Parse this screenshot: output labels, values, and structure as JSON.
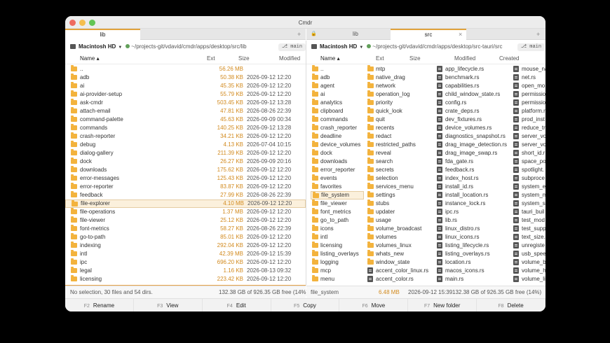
{
  "window": {
    "title": "Cmdr"
  },
  "left": {
    "tab": {
      "label": "lib"
    },
    "drive": "Macintosh HD",
    "path": "~/projects-git/vdavid/cmdr/apps/desktop/src/lib",
    "branch": "main",
    "columns": {
      "name": "Name ▴",
      "ext": "Ext",
      "size": "Size",
      "modified": "Modified"
    },
    "rows": [
      {
        "name": "..",
        "size": "56.26 MB",
        "date": ""
      },
      {
        "name": "adb",
        "size": "50.38 KB",
        "date": "2026-09-12 12:20"
      },
      {
        "name": "ai",
        "size": "45.35 KB",
        "date": "2026-09-12 12:20"
      },
      {
        "name": "ai-provider-setup",
        "size": "55.79 KB",
        "date": "2026-09-12 12:20"
      },
      {
        "name": "ask-cmdr",
        "size": "503.45 KB",
        "date": "2026-09-12 13:28"
      },
      {
        "name": "attach-email",
        "size": "47.81 KB",
        "date": "2026-08-26 22:39"
      },
      {
        "name": "command-palette",
        "size": "45.63 KB",
        "date": "2026-09-09 00:34"
      },
      {
        "name": "commands",
        "size": "140.25 KB",
        "date": "2026-09-12 13:28"
      },
      {
        "name": "crash-reporter",
        "size": "34.21 KB",
        "date": "2026-09-12 12:20"
      },
      {
        "name": "debug",
        "size": "4.13 KB",
        "date": "2026-07-04 10:15"
      },
      {
        "name": "dialog-gallery",
        "size": "211.39 KB",
        "date": "2026-09-12 12:20"
      },
      {
        "name": "dock",
        "size": "26.27 KB",
        "date": "2026-09-09 20:16"
      },
      {
        "name": "downloads",
        "size": "175.62 KB",
        "date": "2026-09-12 12:20"
      },
      {
        "name": "error-messages",
        "size": "125.43 KB",
        "date": "2026-09-12 12:20"
      },
      {
        "name": "error-reporter",
        "size": "83.87 KB",
        "date": "2026-09-12 12:20"
      },
      {
        "name": "feedback",
        "size": "27.99 KB",
        "date": "2026-08-26 22:39"
      },
      {
        "name": "file-explorer",
        "size": "4.10 MB",
        "date": "2026-09-12 12:20"
      },
      {
        "name": "file-operations",
        "size": "1.37 MB",
        "date": "2026-09-12 12:20"
      },
      {
        "name": "file-viewer",
        "size": "25.12 KB",
        "date": "2026-09-12 12:20"
      },
      {
        "name": "font-metrics",
        "size": "58.27 KB",
        "date": "2026-08-26 22:39"
      },
      {
        "name": "go-to-path",
        "size": "85.01 KB",
        "date": "2026-09-12 12:20"
      },
      {
        "name": "indexing",
        "size": "292.04 KB",
        "date": "2026-09-12 12:20"
      },
      {
        "name": "intl",
        "size": "42.39 MB",
        "date": "2026-09-12 15:39"
      },
      {
        "name": "ipc",
        "size": "696.20 KB",
        "date": "2026-09-12 12:20"
      },
      {
        "name": "legal",
        "size": "1.16 KB",
        "date": "2026-08-13 09:32"
      },
      {
        "name": "licensing",
        "size": "223.42 KB",
        "date": "2026-09-12 12:20"
      }
    ],
    "status": {
      "left": "No selection, 30 files and 54 dirs.",
      "right": "132.38 GB of 926.35 GB free (14%)"
    }
  },
  "right": {
    "tab_inactive": {
      "label": "lib"
    },
    "tab": {
      "label": "src"
    },
    "drive": "Macintosh HD",
    "path": "~/projects-git/vdavid/cmdr/apps/desktop/src-tauri/src",
    "branch": "main",
    "columns": {
      "name": "Name ▴",
      "ext": "Ext",
      "size": "Size",
      "modified": "Modified",
      "created": "Created"
    },
    "col1": [
      "..",
      "adb",
      "agent",
      "ai",
      "analytics",
      "clipboard",
      "commands",
      "crash_reporter",
      "deadline",
      "device_volumes",
      "dock",
      "downloads",
      "error_reporter",
      "events",
      "favorites",
      "file_system",
      "file_viewer",
      "font_metrics",
      "go_to_path",
      "icons",
      "intl",
      "licensing",
      "listing_overlays",
      "logging",
      "mcp",
      "menu"
    ],
    "col2": [
      "mtp",
      "native_drag",
      "network",
      "operation_log",
      "priority",
      "quick_look",
      "quit",
      "recents",
      "redact",
      "restricted_paths",
      "reveal",
      "search",
      "secrets",
      "selection",
      "services_menu",
      "settings",
      "stubs",
      "updater",
      "usage",
      "volume_broadcast",
      "volumes",
      "volumes_linux",
      "whats_new",
      "window_state",
      "accent_color_linux.rs",
      "accent_color.rs"
    ],
    "col3": [
      "app_lifecycle.rs",
      "benchmark.rs",
      "capabilities.rs",
      "child_window_state.rs",
      "config.rs",
      "crate_deps.rs",
      "dev_fixtures.rs",
      "device_volumes.rs",
      "diagnostics_snapshot.rs",
      "drag_image_detection.rs",
      "drag_image_swap.rs",
      "fda_gate.rs",
      "feedback.rs",
      "index_host.rs",
      "install_id.rs",
      "install_location.rs",
      "instance_lock.rs",
      "ipc.rs",
      "lib.rs",
      "linux_distro.rs",
      "linux_icons.rs",
      "listing_lifecycle.rs",
      "listing_overlays.rs",
      "location.rs",
      "macos_icons.rs",
      "main.rs"
    ],
    "col4": [
      "mouse_na",
      "net.rs",
      "open_mo",
      "permissio",
      "permissio",
      "platform.r",
      "prod_inst",
      "reduce_tr",
      "server_vo",
      "server_vo",
      "short_id.r",
      "space_po",
      "spotlight.",
      "subproce",
      "system_e",
      "system_m",
      "system_s",
      "tauri_buil",
      "test_mod",
      "test_supp",
      "text_size.",
      "unregiste",
      "usb_spee",
      "volume_b",
      "volume_h",
      "volume_li"
    ],
    "status": {
      "name": "file_system",
      "size": "6.48 MB",
      "date": "2026-09-12 15:39",
      "free": "132.38 GB of 926.35 GB free (14%)"
    }
  },
  "function_keys": [
    {
      "key": "F2",
      "label": "Rename"
    },
    {
      "key": "F3",
      "label": "View"
    },
    {
      "key": "F4",
      "label": "Edit"
    },
    {
      "key": "F5",
      "label": "Copy"
    },
    {
      "key": "F6",
      "label": "Move"
    },
    {
      "key": "F7",
      "label": "New folder"
    },
    {
      "key": "F8",
      "label": "Delete"
    }
  ],
  "icons": {
    "plus": "+",
    "close": "×",
    "lock": "🔒",
    "branch": "⎇"
  },
  "colors": {
    "accent": "#e8a54a",
    "folder": "#f3b33d",
    "size_text": "#d28a1e"
  }
}
